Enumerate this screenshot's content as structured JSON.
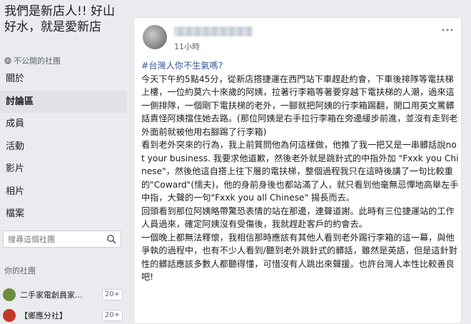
{
  "sidebar": {
    "group_title": "我們是新店人!! 好山好水，就是愛新店",
    "privacy": "不公開的社團",
    "nav": [
      "關於",
      "討論區",
      "成員",
      "活動",
      "影片",
      "相片",
      "檔案"
    ],
    "active_index": 1,
    "search_placeholder": "搜尋這個社團",
    "your_groups_label": "你的社團",
    "groups": [
      {
        "name": "二手家電創員家...",
        "count": "20+"
      },
      {
        "name": "【鄉應分社】",
        "count": "20+"
      }
    ]
  },
  "post": {
    "time": "11小時",
    "hashtag": "#台灣人你不生氣嗎?",
    "paragraphs": [
      "今天下午約5點45分，從新店搭捷運在西門站下車趕赴約會，下車後排隊等電扶梯上樓，一位約莫六十來歲的阿姨，拉著行李箱等著要穿越下電扶梯的人潮，過來這一側排隊，一個剛下電扶梯的老外，一腳就把阿姨的行李箱踢翻，開口用英文罵髒話責怪阿姨擋住她去路。(那位阿姨是右手拉行李箱在旁邊緩步前進，並沒有走到老外面前就被他用右腳踢了行李箱)",
      "看到老外突來的行為，我上前質問他為何這樣做，他推了我一把又是一串髒話說not your business. 我要求他道歉，然後老外就是跳針式的中指外加 \"Fxxk you Chinese\"，然後他這自搭上往下層的電扶梯，整個過程我只在這時後講了一句比較重的\"Coward\"(懦夫)，他的身前身後也都站滿了人，就只看到他毫無忌憚地高舉左手中指，大聲的一句\"Fxxk you all Chinese\" 揚長而去。",
      "回頭看到那位阿姨略帶驚恐表情的站在那邊，連聲道謝。此時有三位捷運站的工作人員過來，確定阿姨沒有受傷後，我就趕赴客戶的約會去。",
      "一個晚上都無法釋懷，我相信那時應該有其他人看到老外踢行李箱的這一幕，與他爭執的過程中，也有不少人看到/聽到老外跳針式的髒話，雖然是英語，但是這針對性的髒話應該多數人都聽得懂，可惜沒有人跳出來聲援。也許台灣人本性比較善良吧!"
    ]
  },
  "colors": {
    "background": "#e9ebee",
    "card": "#ffffff",
    "link": "#385898"
  }
}
